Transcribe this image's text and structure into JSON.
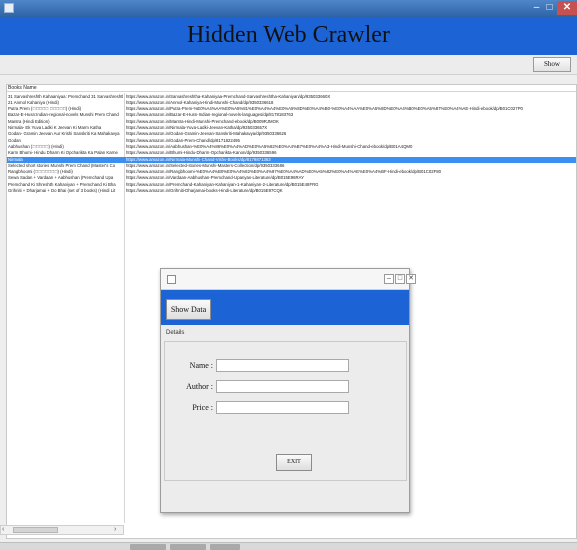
{
  "window": {
    "minimize_glyph": "–",
    "maximize_glyph": "□",
    "close_glyph": "✕"
  },
  "header": {
    "title": "Hidden Web Crawler"
  },
  "toolbar": {
    "show_label": "Show"
  },
  "table": {
    "column_header": "Books Name",
    "rows": [
      {
        "name": "31 Sarvashreshth Kahaaniyaa: Premchand 31 Sarvashreshth",
        "url": "https://www.amazon.in/Sarvashreshtha-Kahaniyaa-Premchand-Sarvashreshtha-Kahaniyan/dp/935033660X"
      },
      {
        "name": "21 Anmol Kahaniya (Hindi)",
        "url": "https://www.amazon.in/Anmol-Kahaniya-Hindi-Munshi-Chand/dp/9350336618"
      },
      {
        "name": "Putra Prem (\u0000\u0000\u0000\u0000\u0000 \u0000\u0000\u0000\u0000\u0000) (Hindi)",
        "url": "https://www.amazon.in/Putra-Prem-%E0%A4%AA%E0%A5%81%E0%A4%A4%E0%A5%8D%E0%A4%B0-%E0%A4%AA%E0%A5%8D%E0%A4%B0%E0%A5%87%E0%A4%AE-Hindi-ebook/dp/B01C027P0"
      },
      {
        "name": "Bazar-E-Husn:Indian-regional-novels Munshi Prem Chand",
        "url": "https://www.amazon.in/Bazar-E-Husn-Indian-regional-novels-languages/dp/8178183763"
      },
      {
        "name": "Mantra (Hindi Edition)",
        "url": "https://www.amazon.in/Mantra-Hindi-Munshi-Premchand-ebook/dp/B009RJMOK"
      },
      {
        "name": "Nirmala- Ek Yuva Ladki K Jeevan Ki Marm Katha",
        "url": "https://www.amazon.in/Nirmala-Yuva-Ladki-Jeevan-Katha/dp/935033657X"
      },
      {
        "name": "Godan- Gramin Jeevan Aur Krishi Sanskriti Ka Mahakavya",
        "url": "https://www.amazon.in/Godan-Gramin-Jeevan-Sanskriti-Mahakavya/dp/9350336626"
      },
      {
        "name": "Godan",
        "url": "https://www.amazon.in/Godan-Prem-Chand/dp/8171822495"
      },
      {
        "name": "Aabhushan (\u0000\u0000\u0000\u0000\u0000) (Hindi)",
        "url": "https://www.amazon.in/Aabhushan-%E0%A4%86%E0%A4%AD%E0%A5%82%E0%A4%B7%E0%A4%A3-Hindi-Munshi-Chand-ebook/dp/B01A4QM0"
      },
      {
        "name": "Karm Bhumi- Hindu Dharm Ki Opcharikta Ka Palan Karne",
        "url": "https://www.amazon.in/Bhumi-Hindu-Dharm-Opcharikta-Kanon/dp/9350336596"
      },
      {
        "name": "Nirmala",
        "url": "https://www.amazon.in/Nirmala-Munshi-Chand-Vishv-Books/dp/8179871363"
      },
      {
        "name": "Selected short stories Munshi Prem Chand (Master's Co",
        "url": "https://www.amazon.in/Selected-stories-Munshi-Masters-Collection/dp/9350333686"
      },
      {
        "name": "Rangbhoomi (\u0000\u0000\u0000\u0000\u0000\u0000\u0000) (Hindi)",
        "url": "https://www.amazon.in/Rangbhoomi-%E0%A4%B0%E0%A4%82%E0%A4%97%E0%A4%AD%E0%A5%82%E0%A4%AE%E0%A4%BF-Hindi-ebook/dp/B01C02F80"
      },
      {
        "name": "Sewa Sadan + Vardaan + Aabhushan (Premchand Upa",
        "url": "https://www.amazon.in/Vardaan-Aabhushan-Premchand-Upanyas-Literature/dp/B015E96RAY"
      },
      {
        "name": "Premchand Ki Shreshth Kahaniyan + Premchand Ki Bha",
        "url": "https://www.amazon.in/Premchand-Kahaniyan-Kahaniyan-1-Kahaniyan-2-Literature/dp/B015E48FRG"
      },
      {
        "name": "Grihniti + Dharjamai + Do Bhai (set of 3 books) (Hindi Lit",
        "url": "https://www.amazon.in/Grihniti-Dharjamai-books-Hindi-Literature/dp/B015E97CQK"
      }
    ],
    "selected_index": 10
  },
  "dialog": {
    "minimize_glyph": "–",
    "maximize_glyph": "□",
    "close_glyph": "✕",
    "show_data_label": "Show Data",
    "details_label": "Details",
    "name_label": "Name :",
    "author_label": "Author :",
    "price_label": "Price :",
    "name_value": "",
    "author_value": "",
    "price_value": "",
    "exit_label": "EXIT"
  },
  "scrollbar": {
    "left_arrow": "‹",
    "right_arrow": "›"
  },
  "colors": {
    "accent_blue": "#1c64d6",
    "selection_blue": "#3b8ef2",
    "title_bar": "#3a70b8"
  }
}
